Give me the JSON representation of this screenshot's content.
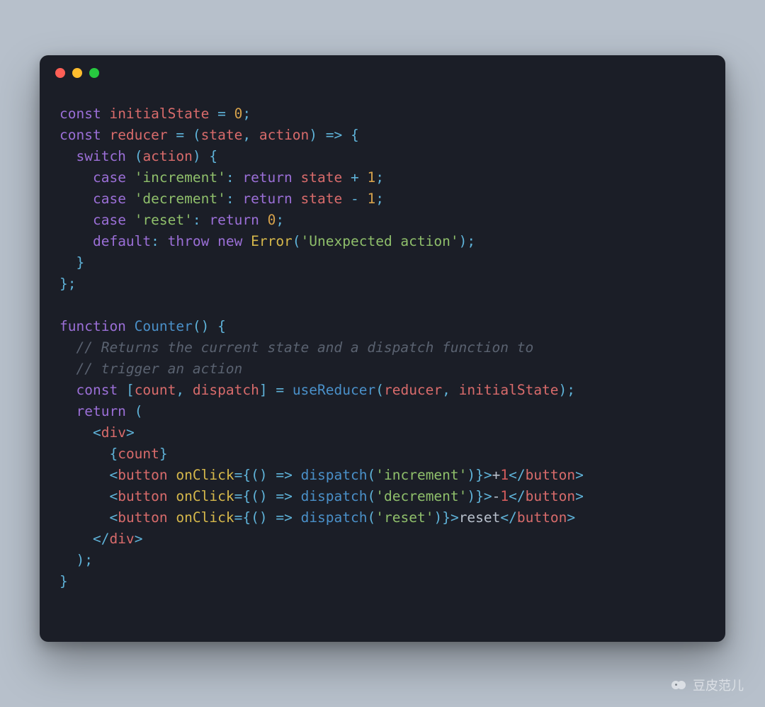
{
  "window": {
    "traffic_lights": [
      "red",
      "yellow",
      "green"
    ]
  },
  "colors": {
    "background": "#b7c0cb",
    "editor_bg": "#1b1e27",
    "keyword": "#9b6fd7",
    "operator": "#5fb3d9",
    "identifier": "#d86b6b",
    "string": "#8fbf6b",
    "number": "#d6a24b",
    "class": "#d6b84b",
    "function": "#4a90c9",
    "comment": "#5a6270"
  },
  "code": {
    "language": "javascript-jsx",
    "lines": [
      [
        [
          "kw",
          "const"
        ],
        [
          "white",
          " "
        ],
        [
          "var",
          "initialState"
        ],
        [
          "white",
          " "
        ],
        [
          "op",
          "="
        ],
        [
          "white",
          " "
        ],
        [
          "num",
          "0"
        ],
        [
          "op",
          ";"
        ]
      ],
      [
        [
          "kw",
          "const"
        ],
        [
          "white",
          " "
        ],
        [
          "var",
          "reducer"
        ],
        [
          "white",
          " "
        ],
        [
          "op",
          "="
        ],
        [
          "white",
          " "
        ],
        [
          "op",
          "("
        ],
        [
          "var",
          "state"
        ],
        [
          "op",
          ","
        ],
        [
          "white",
          " "
        ],
        [
          "var",
          "action"
        ],
        [
          "op",
          ")"
        ],
        [
          "white",
          " "
        ],
        [
          "op",
          "=>"
        ],
        [
          "white",
          " "
        ],
        [
          "op",
          "{"
        ]
      ],
      [
        [
          "white",
          "  "
        ],
        [
          "kw",
          "switch"
        ],
        [
          "white",
          " "
        ],
        [
          "op",
          "("
        ],
        [
          "var",
          "action"
        ],
        [
          "op",
          ")"
        ],
        [
          "white",
          " "
        ],
        [
          "op",
          "{"
        ]
      ],
      [
        [
          "white",
          "    "
        ],
        [
          "kw",
          "case"
        ],
        [
          "white",
          " "
        ],
        [
          "str",
          "'increment'"
        ],
        [
          "op",
          ":"
        ],
        [
          "white",
          " "
        ],
        [
          "kw",
          "return"
        ],
        [
          "white",
          " "
        ],
        [
          "var",
          "state"
        ],
        [
          "white",
          " "
        ],
        [
          "op",
          "+"
        ],
        [
          "white",
          " "
        ],
        [
          "num",
          "1"
        ],
        [
          "op",
          ";"
        ]
      ],
      [
        [
          "white",
          "    "
        ],
        [
          "kw",
          "case"
        ],
        [
          "white",
          " "
        ],
        [
          "str",
          "'decrement'"
        ],
        [
          "op",
          ":"
        ],
        [
          "white",
          " "
        ],
        [
          "kw",
          "return"
        ],
        [
          "white",
          " "
        ],
        [
          "var",
          "state"
        ],
        [
          "white",
          " "
        ],
        [
          "op",
          "-"
        ],
        [
          "white",
          " "
        ],
        [
          "num",
          "1"
        ],
        [
          "op",
          ";"
        ]
      ],
      [
        [
          "white",
          "    "
        ],
        [
          "kw",
          "case"
        ],
        [
          "white",
          " "
        ],
        [
          "str",
          "'reset'"
        ],
        [
          "op",
          ":"
        ],
        [
          "white",
          " "
        ],
        [
          "kw",
          "return"
        ],
        [
          "white",
          " "
        ],
        [
          "num",
          "0"
        ],
        [
          "op",
          ";"
        ]
      ],
      [
        [
          "white",
          "    "
        ],
        [
          "kw",
          "default"
        ],
        [
          "op",
          ":"
        ],
        [
          "white",
          " "
        ],
        [
          "kw",
          "throw"
        ],
        [
          "white",
          " "
        ],
        [
          "kw",
          "new"
        ],
        [
          "white",
          " "
        ],
        [
          "cls",
          "Error"
        ],
        [
          "op",
          "("
        ],
        [
          "str",
          "'Unexpected action'"
        ],
        [
          "op",
          ")"
        ],
        [
          "op",
          ";"
        ]
      ],
      [
        [
          "white",
          "  "
        ],
        [
          "op",
          "}"
        ]
      ],
      [
        [
          "op",
          "}"
        ],
        [
          "op",
          ";"
        ]
      ],
      [],
      [
        [
          "kw",
          "function"
        ],
        [
          "white",
          " "
        ],
        [
          "fn",
          "Counter"
        ],
        [
          "op",
          "("
        ],
        [
          "op",
          ")"
        ],
        [
          "white",
          " "
        ],
        [
          "op",
          "{"
        ]
      ],
      [
        [
          "white",
          "  "
        ],
        [
          "cmt",
          "// Returns the current state and a dispatch function to"
        ]
      ],
      [
        [
          "white",
          "  "
        ],
        [
          "cmt",
          "// trigger an action"
        ]
      ],
      [
        [
          "white",
          "  "
        ],
        [
          "kw",
          "const"
        ],
        [
          "white",
          " "
        ],
        [
          "op",
          "["
        ],
        [
          "var",
          "count"
        ],
        [
          "op",
          ","
        ],
        [
          "white",
          " "
        ],
        [
          "var",
          "dispatch"
        ],
        [
          "op",
          "]"
        ],
        [
          "white",
          " "
        ],
        [
          "op",
          "="
        ],
        [
          "white",
          " "
        ],
        [
          "fn",
          "useReducer"
        ],
        [
          "op",
          "("
        ],
        [
          "var",
          "reducer"
        ],
        [
          "op",
          ","
        ],
        [
          "white",
          " "
        ],
        [
          "var",
          "initialState"
        ],
        [
          "op",
          ")"
        ],
        [
          "op",
          ";"
        ]
      ],
      [
        [
          "white",
          "  "
        ],
        [
          "kw",
          "return"
        ],
        [
          "white",
          " "
        ],
        [
          "op",
          "("
        ]
      ],
      [
        [
          "white",
          "    "
        ],
        [
          "op",
          "<"
        ],
        [
          "var",
          "div"
        ],
        [
          "op",
          ">"
        ]
      ],
      [
        [
          "white",
          "      "
        ],
        [
          "op",
          "{"
        ],
        [
          "var",
          "count"
        ],
        [
          "op",
          "}"
        ]
      ],
      [
        [
          "white",
          "      "
        ],
        [
          "op",
          "<"
        ],
        [
          "var",
          "button"
        ],
        [
          "white",
          " "
        ],
        [
          "jsxattr",
          "onClick"
        ],
        [
          "op",
          "="
        ],
        [
          "op",
          "{"
        ],
        [
          "op",
          "("
        ],
        [
          "op",
          ")"
        ],
        [
          "white",
          " "
        ],
        [
          "op",
          "=>"
        ],
        [
          "white",
          " "
        ],
        [
          "fn",
          "dispatch"
        ],
        [
          "op",
          "("
        ],
        [
          "str",
          "'increment'"
        ],
        [
          "op",
          ")"
        ],
        [
          "op",
          "}"
        ],
        [
          "op",
          ">"
        ],
        [
          "jsxtxt",
          "+"
        ],
        [
          "jsxnum",
          "1"
        ],
        [
          "op",
          "</"
        ],
        [
          "var",
          "button"
        ],
        [
          "op",
          ">"
        ]
      ],
      [
        [
          "white",
          "      "
        ],
        [
          "op",
          "<"
        ],
        [
          "var",
          "button"
        ],
        [
          "white",
          " "
        ],
        [
          "jsxattr",
          "onClick"
        ],
        [
          "op",
          "="
        ],
        [
          "op",
          "{"
        ],
        [
          "op",
          "("
        ],
        [
          "op",
          ")"
        ],
        [
          "white",
          " "
        ],
        [
          "op",
          "=>"
        ],
        [
          "white",
          " "
        ],
        [
          "fn",
          "dispatch"
        ],
        [
          "op",
          "("
        ],
        [
          "str",
          "'decrement'"
        ],
        [
          "op",
          ")"
        ],
        [
          "op",
          "}"
        ],
        [
          "op",
          ">"
        ],
        [
          "jsxtxt",
          "-"
        ],
        [
          "jsxnum",
          "1"
        ],
        [
          "op",
          "</"
        ],
        [
          "var",
          "button"
        ],
        [
          "op",
          ">"
        ]
      ],
      [
        [
          "white",
          "      "
        ],
        [
          "op",
          "<"
        ],
        [
          "var",
          "button"
        ],
        [
          "white",
          " "
        ],
        [
          "jsxattr",
          "onClick"
        ],
        [
          "op",
          "="
        ],
        [
          "op",
          "{"
        ],
        [
          "op",
          "("
        ],
        [
          "op",
          ")"
        ],
        [
          "white",
          " "
        ],
        [
          "op",
          "=>"
        ],
        [
          "white",
          " "
        ],
        [
          "fn",
          "dispatch"
        ],
        [
          "op",
          "("
        ],
        [
          "str",
          "'reset'"
        ],
        [
          "op",
          ")"
        ],
        [
          "op",
          "}"
        ],
        [
          "op",
          ">"
        ],
        [
          "jsxtxt",
          "reset"
        ],
        [
          "op",
          "</"
        ],
        [
          "var",
          "button"
        ],
        [
          "op",
          ">"
        ]
      ],
      [
        [
          "white",
          "    "
        ],
        [
          "op",
          "</"
        ],
        [
          "var",
          "div"
        ],
        [
          "op",
          ">"
        ]
      ],
      [
        [
          "white",
          "  "
        ],
        [
          "op",
          ")"
        ],
        [
          "op",
          ";"
        ]
      ],
      [
        [
          "op",
          "}"
        ]
      ]
    ]
  },
  "watermark": {
    "text": "豆皮范儿"
  }
}
